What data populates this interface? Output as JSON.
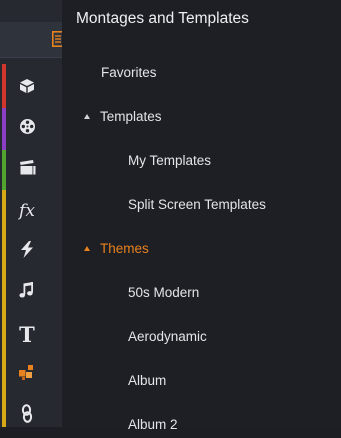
{
  "panel": {
    "title": "Montages and Templates"
  },
  "tree": {
    "favorites": "Favorites",
    "templates": "Templates",
    "my_templates": "My Templates",
    "split_screen": "Split Screen Templates",
    "themes": "Themes",
    "fifties_modern": "50s Modern",
    "aerodynamic": "Aerodynamic",
    "album": "Album",
    "album2": "Album 2"
  },
  "rail": {
    "icons": [
      "template-icon",
      "box-icon",
      "film-reel-icon",
      "clapperboard-icon",
      "fx-icon",
      "lightning-icon",
      "music-note-icon",
      "title-t-icon",
      "blocks-icon",
      "link-icon"
    ],
    "fx_text": "fx",
    "title_text": "T"
  },
  "colors": {
    "accent_orange": "#e8821e",
    "stripe_red": "#d0362c",
    "stripe_purple": "#8b3fc5",
    "stripe_green": "#52a52e",
    "stripe_yellow": "#d6a813"
  }
}
